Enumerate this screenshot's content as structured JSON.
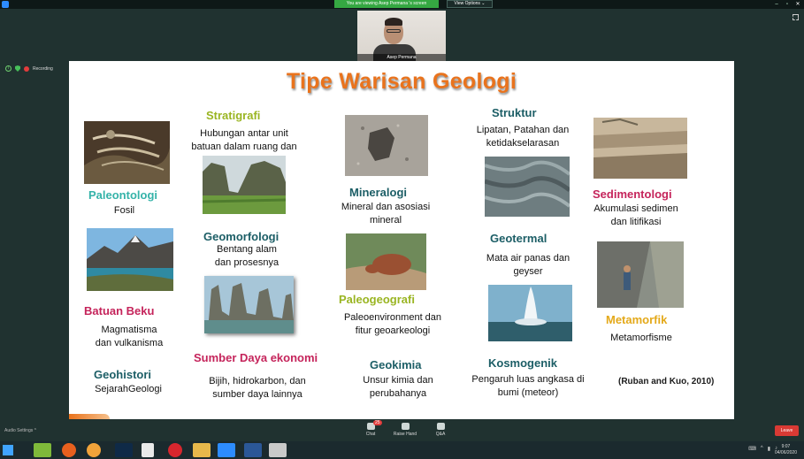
{
  "window": {
    "share_banner": "You are viewing Asep Permana 's screen",
    "view_options": "View Options ⌄",
    "controls": {
      "minimize": "–",
      "maximize": "▫",
      "close": "✕"
    }
  },
  "video": {
    "name": "Asep Permana"
  },
  "recording": {
    "label": "Recording"
  },
  "slide": {
    "title": "Tipe Warisan Geologi",
    "items": {
      "stratigrafi": {
        "label": "Stratigrafi",
        "desc1": "Hubungan antar unit",
        "desc2": "batuan dalam ruang dan"
      },
      "paleontologi": {
        "label": "Paleontologi",
        "desc1": "Fosil"
      },
      "geomorfologi": {
        "label": "Geomorfologi",
        "desc1": "Bentang alam",
        "desc2": "dan prosesnya"
      },
      "batuan_beku": {
        "label": "Batuan Beku",
        "desc1": "Magmatisma",
        "desc2": "dan vulkanisma"
      },
      "sumber_daya": {
        "label": "Sumber Daya ekonomi",
        "desc1": "Bijih, hidrokarbon, dan",
        "desc2": "sumber daya lainnya"
      },
      "geohistori": {
        "label": "Geohistori",
        "desc1": "SejarahGeologi"
      },
      "mineralogi": {
        "label": "Mineralogi",
        "desc1": "Mineral dan asosiasi",
        "desc2": "mineral"
      },
      "paleogeografi": {
        "label": "Paleogeografi",
        "desc1": "Paleoenvironment dan",
        "desc2": "fitur geoarkeologi"
      },
      "geokimia": {
        "label": "Geokimia",
        "desc1": "Unsur kimia dan",
        "desc2": "perubahanya"
      },
      "struktur": {
        "label": "Struktur",
        "desc1": "Lipatan, Patahan dan",
        "desc2": "ketidakselarasan"
      },
      "geotermal": {
        "label": "Geotermal",
        "desc1": "Mata air panas dan",
        "desc2": "geyser"
      },
      "kosmogenik": {
        "label": "Kosmogenik",
        "desc1": "Pengaruh luas angkasa di",
        "desc2": "bumi (meteor)"
      },
      "sedimentologi": {
        "label": "Sedimentologi",
        "desc1": "Akumulasi sedimen",
        "desc2": "dan litifikasi"
      },
      "metamorfik": {
        "label": "Metamorfik",
        "desc1": "Metamorfisme"
      }
    },
    "reference": "(Ruban and Kuo, 2010)"
  },
  "controls": {
    "audio_settings": "Audio Settings ^",
    "chat": "Chat",
    "chat_badge": "25",
    "raise_hand": "Raise Hand",
    "qa": "Q&A",
    "leave": "Leave"
  },
  "taskbar": {
    "time": "9:07",
    "date": "04/06/2020"
  },
  "colors": {
    "title": "#e9731d",
    "teal": "#1b9b95",
    "olive": "#9ab522",
    "dark_teal": "#1c5e66",
    "magenta": "#c5245b",
    "gold": "#e4a91a"
  }
}
